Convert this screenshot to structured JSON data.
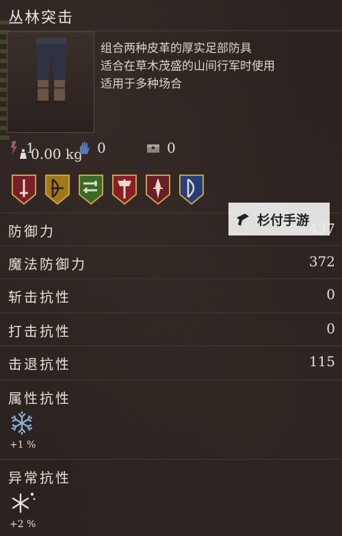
{
  "item": {
    "title": "丛林突击",
    "weight": "0.00 kg",
    "description": [
      "组合两种皮革的厚实足部防具",
      "适合在草木茂盛的山间行军时使用",
      "适用于多种场合"
    ]
  },
  "requirements": [
    {
      "icon": "strength-rune-icon",
      "value": "1"
    },
    {
      "icon": "magic-hand-icon",
      "value": "0"
    },
    {
      "icon": "chest-icon",
      "value": "0"
    }
  ],
  "classes": [
    {
      "icon": "sword-icon",
      "color": "#7a1e28"
    },
    {
      "icon": "bow-icon",
      "color": "#a07818"
    },
    {
      "icon": "dual-daggers-icon",
      "color": "#3a6a28"
    },
    {
      "icon": "axe-icon",
      "color": "#8a1e24"
    },
    {
      "icon": "twin-blades-icon",
      "color": "#6a1e2a"
    },
    {
      "icon": "bow-shield-icon",
      "color": "#283e7a"
    }
  ],
  "stats": [
    {
      "label": "防御力",
      "value": "437"
    },
    {
      "label": "魔法防御力",
      "value": "372"
    },
    {
      "label": "斩击抗性",
      "value": "0"
    },
    {
      "label": "打击抗性",
      "value": "0"
    },
    {
      "label": "击退抗性",
      "value": "115"
    }
  ],
  "resistances": {
    "elemental": {
      "label": "属性抗性",
      "icon": "snowflake-icon",
      "value": "+1 %"
    },
    "status": {
      "label": "异常抗性",
      "icon": "frost-sparkle-icon",
      "value": "+2 %"
    }
  },
  "watermark": {
    "text": "杉付手游"
  }
}
